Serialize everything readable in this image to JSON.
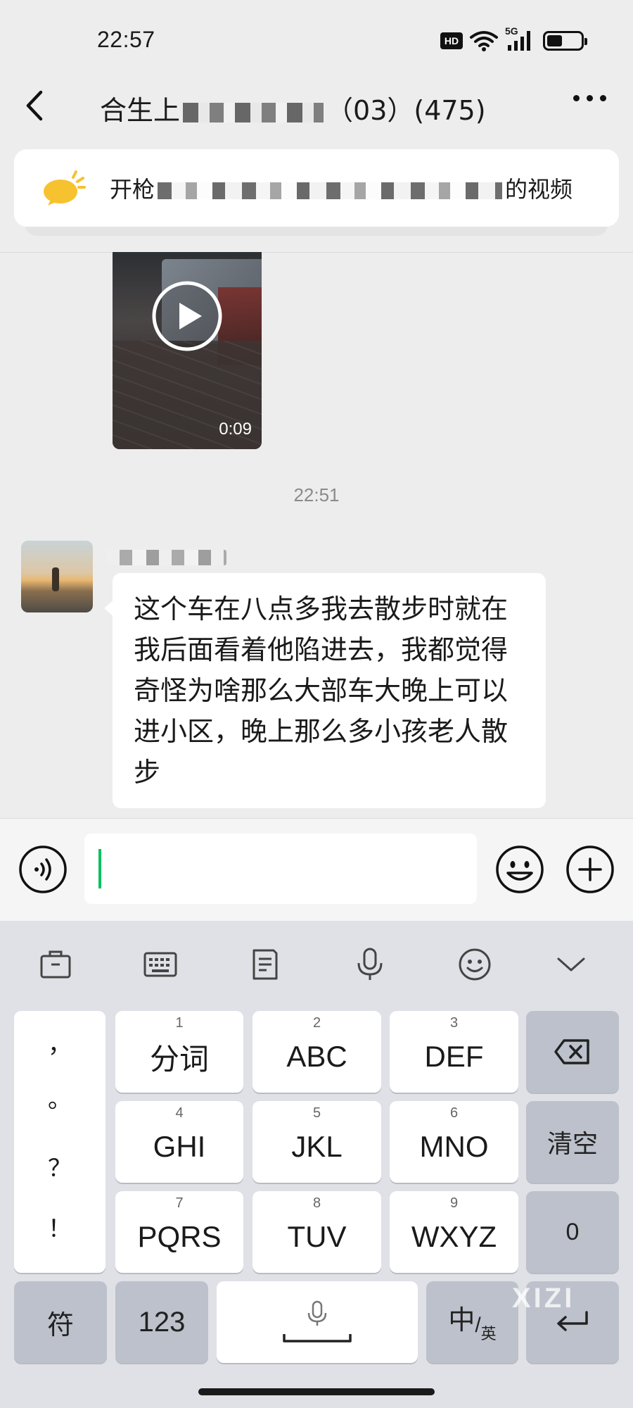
{
  "status_bar": {
    "time": "22:57",
    "hd_label": "HD",
    "network_label": "5G",
    "battery_level": 0.45
  },
  "header": {
    "title_prefix": "合生上",
    "title_suffix": "（03）(475)"
  },
  "notice": {
    "prefix": "开枪",
    "suffix": "的视频"
  },
  "video": {
    "duration": "0:09"
  },
  "timestamp": "22:51",
  "message": {
    "text": "这个车在八点多我去散步时就在我后面看着他陷进去，我都觉得奇怪为啥那么大部车大晚上可以进小区，晚上那么多小孩老人散步"
  },
  "keyboard": {
    "punctuation": [
      "，",
      "。",
      "？",
      "！"
    ],
    "rows": [
      [
        {
          "num": "1",
          "label": "分词"
        },
        {
          "num": "2",
          "label": "ABC"
        },
        {
          "num": "3",
          "label": "DEF"
        }
      ],
      [
        {
          "num": "4",
          "label": "GHI"
        },
        {
          "num": "5",
          "label": "JKL"
        },
        {
          "num": "6",
          "label": "MNO"
        }
      ],
      [
        {
          "num": "7",
          "label": "PQRS"
        },
        {
          "num": "8",
          "label": "TUV"
        },
        {
          "num": "9",
          "label": "WXYZ"
        }
      ]
    ],
    "clear_label": "清空",
    "zero_label": "0",
    "symbol_label": "符",
    "numeric_label": "123",
    "lang_main": "中",
    "lang_sub": "英"
  },
  "watermark": "XIZI",
  "colors": {
    "accent": "#07c160",
    "background": "#ededed",
    "keyboard": "#dfe1e6",
    "notice_icon": "#f7c22f"
  }
}
